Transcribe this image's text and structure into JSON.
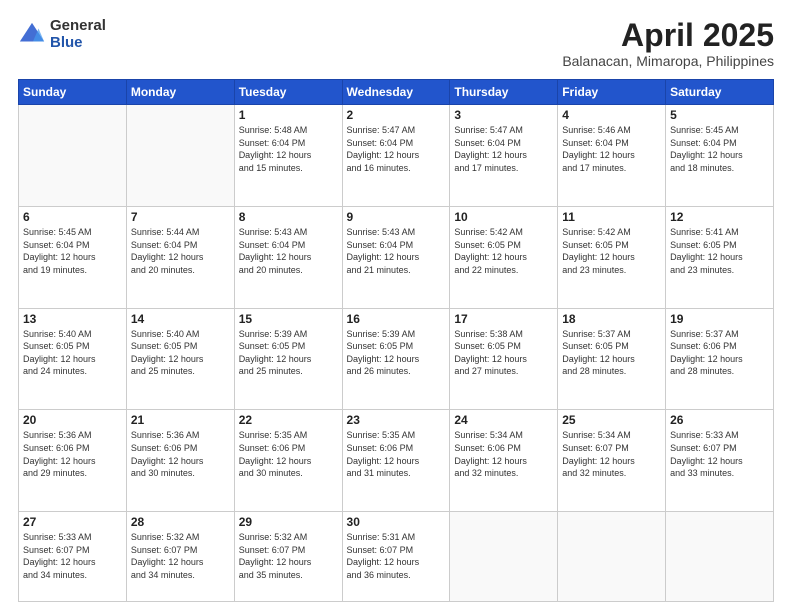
{
  "header": {
    "logo_general": "General",
    "logo_blue": "Blue",
    "title": "April 2025",
    "location": "Balanacan, Mimaropa, Philippines"
  },
  "weekdays": [
    "Sunday",
    "Monday",
    "Tuesday",
    "Wednesday",
    "Thursday",
    "Friday",
    "Saturday"
  ],
  "weeks": [
    [
      {
        "day": "",
        "info": ""
      },
      {
        "day": "",
        "info": ""
      },
      {
        "day": "1",
        "info": "Sunrise: 5:48 AM\nSunset: 6:04 PM\nDaylight: 12 hours\nand 15 minutes."
      },
      {
        "day": "2",
        "info": "Sunrise: 5:47 AM\nSunset: 6:04 PM\nDaylight: 12 hours\nand 16 minutes."
      },
      {
        "day": "3",
        "info": "Sunrise: 5:47 AM\nSunset: 6:04 PM\nDaylight: 12 hours\nand 17 minutes."
      },
      {
        "day": "4",
        "info": "Sunrise: 5:46 AM\nSunset: 6:04 PM\nDaylight: 12 hours\nand 17 minutes."
      },
      {
        "day": "5",
        "info": "Sunrise: 5:45 AM\nSunset: 6:04 PM\nDaylight: 12 hours\nand 18 minutes."
      }
    ],
    [
      {
        "day": "6",
        "info": "Sunrise: 5:45 AM\nSunset: 6:04 PM\nDaylight: 12 hours\nand 19 minutes."
      },
      {
        "day": "7",
        "info": "Sunrise: 5:44 AM\nSunset: 6:04 PM\nDaylight: 12 hours\nand 20 minutes."
      },
      {
        "day": "8",
        "info": "Sunrise: 5:43 AM\nSunset: 6:04 PM\nDaylight: 12 hours\nand 20 minutes."
      },
      {
        "day": "9",
        "info": "Sunrise: 5:43 AM\nSunset: 6:04 PM\nDaylight: 12 hours\nand 21 minutes."
      },
      {
        "day": "10",
        "info": "Sunrise: 5:42 AM\nSunset: 6:05 PM\nDaylight: 12 hours\nand 22 minutes."
      },
      {
        "day": "11",
        "info": "Sunrise: 5:42 AM\nSunset: 6:05 PM\nDaylight: 12 hours\nand 23 minutes."
      },
      {
        "day": "12",
        "info": "Sunrise: 5:41 AM\nSunset: 6:05 PM\nDaylight: 12 hours\nand 23 minutes."
      }
    ],
    [
      {
        "day": "13",
        "info": "Sunrise: 5:40 AM\nSunset: 6:05 PM\nDaylight: 12 hours\nand 24 minutes."
      },
      {
        "day": "14",
        "info": "Sunrise: 5:40 AM\nSunset: 6:05 PM\nDaylight: 12 hours\nand 25 minutes."
      },
      {
        "day": "15",
        "info": "Sunrise: 5:39 AM\nSunset: 6:05 PM\nDaylight: 12 hours\nand 25 minutes."
      },
      {
        "day": "16",
        "info": "Sunrise: 5:39 AM\nSunset: 6:05 PM\nDaylight: 12 hours\nand 26 minutes."
      },
      {
        "day": "17",
        "info": "Sunrise: 5:38 AM\nSunset: 6:05 PM\nDaylight: 12 hours\nand 27 minutes."
      },
      {
        "day": "18",
        "info": "Sunrise: 5:37 AM\nSunset: 6:05 PM\nDaylight: 12 hours\nand 28 minutes."
      },
      {
        "day": "19",
        "info": "Sunrise: 5:37 AM\nSunset: 6:06 PM\nDaylight: 12 hours\nand 28 minutes."
      }
    ],
    [
      {
        "day": "20",
        "info": "Sunrise: 5:36 AM\nSunset: 6:06 PM\nDaylight: 12 hours\nand 29 minutes."
      },
      {
        "day": "21",
        "info": "Sunrise: 5:36 AM\nSunset: 6:06 PM\nDaylight: 12 hours\nand 30 minutes."
      },
      {
        "day": "22",
        "info": "Sunrise: 5:35 AM\nSunset: 6:06 PM\nDaylight: 12 hours\nand 30 minutes."
      },
      {
        "day": "23",
        "info": "Sunrise: 5:35 AM\nSunset: 6:06 PM\nDaylight: 12 hours\nand 31 minutes."
      },
      {
        "day": "24",
        "info": "Sunrise: 5:34 AM\nSunset: 6:06 PM\nDaylight: 12 hours\nand 32 minutes."
      },
      {
        "day": "25",
        "info": "Sunrise: 5:34 AM\nSunset: 6:07 PM\nDaylight: 12 hours\nand 32 minutes."
      },
      {
        "day": "26",
        "info": "Sunrise: 5:33 AM\nSunset: 6:07 PM\nDaylight: 12 hours\nand 33 minutes."
      }
    ],
    [
      {
        "day": "27",
        "info": "Sunrise: 5:33 AM\nSunset: 6:07 PM\nDaylight: 12 hours\nand 34 minutes."
      },
      {
        "day": "28",
        "info": "Sunrise: 5:32 AM\nSunset: 6:07 PM\nDaylight: 12 hours\nand 34 minutes."
      },
      {
        "day": "29",
        "info": "Sunrise: 5:32 AM\nSunset: 6:07 PM\nDaylight: 12 hours\nand 35 minutes."
      },
      {
        "day": "30",
        "info": "Sunrise: 5:31 AM\nSunset: 6:07 PM\nDaylight: 12 hours\nand 36 minutes."
      },
      {
        "day": "",
        "info": ""
      },
      {
        "day": "",
        "info": ""
      },
      {
        "day": "",
        "info": ""
      }
    ]
  ]
}
